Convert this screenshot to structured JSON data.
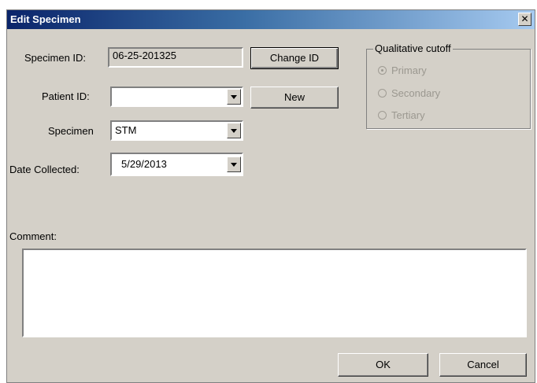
{
  "window": {
    "title": "Edit Specimen",
    "close_glyph": "✕"
  },
  "form": {
    "specimen_id_label": "Specimen ID:",
    "specimen_id_value": "06-25-201325",
    "change_id_button": "Change ID",
    "patient_id_label": "Patient ID:",
    "patient_id_value": "",
    "new_button": "New",
    "specimen_label": "Specimen",
    "specimen_value": "STM",
    "date_collected_label": "Date Collected:",
    "date_collected_value": "5/29/2013",
    "comment_label": "Comment:",
    "comment_value": ""
  },
  "cutoff": {
    "title": "Qualitative cutoff",
    "options": [
      {
        "label": "Primary",
        "selected": true
      },
      {
        "label": "Secondary",
        "selected": false
      },
      {
        "label": "Tertiary",
        "selected": false
      }
    ]
  },
  "footer": {
    "ok_button": "OK",
    "cancel_button": "Cancel"
  }
}
